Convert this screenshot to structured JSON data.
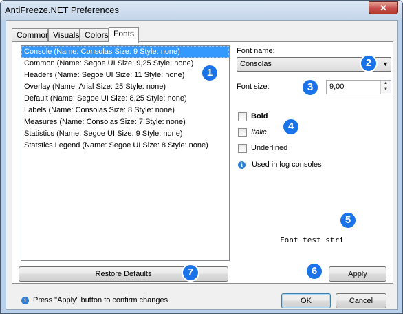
{
  "window": {
    "title": "AntiFreeze.NET Preferences",
    "close_glyph": "✕"
  },
  "tabs": [
    {
      "label": "Common",
      "active": false
    },
    {
      "label": "Visuals",
      "active": false
    },
    {
      "label": "Colors",
      "active": false
    },
    {
      "label": "Fonts",
      "active": true
    }
  ],
  "font_list": {
    "selected_index": 0,
    "items": [
      "Console (Name: Consolas Size: 9 Style: none)",
      "Common (Name: Segoe UI Size: 9,25 Style: none)",
      "Headers (Name: Segoe UI Size: 11 Style: none)",
      "Overlay (Name: Arial Size: 25 Style: none)",
      "Default (Name: Segoe UI Size: 8,25 Style: none)",
      "Labels (Name: Consolas Size: 8 Style: none)",
      "Measures (Name: Consolas Size: 7 Style: none)",
      "Statistics (Name: Segoe UI Size: 9 Style: none)",
      "Statstics Legend (Name: Segoe UI Size: 8 Style: none)"
    ]
  },
  "font_name": {
    "label": "Font name:",
    "value": "Consolas"
  },
  "font_size": {
    "label": "Font size:",
    "value": "9,00"
  },
  "styles": {
    "bold": "Bold",
    "italic": "Italic",
    "underlined": "Underlined"
  },
  "info_note": "Used in log consoles",
  "preview_text": "Font test stri",
  "buttons": {
    "restore": "Restore Defaults",
    "apply": "Apply",
    "ok": "OK",
    "cancel": "Cancel"
  },
  "status_text": "Press \"Apply\" button to confirm changes",
  "badges": [
    "1",
    "2",
    "3",
    "4",
    "5",
    "6",
    "7"
  ],
  "colors": {
    "selection": "#3399ff",
    "badge": "#1a73e8"
  }
}
